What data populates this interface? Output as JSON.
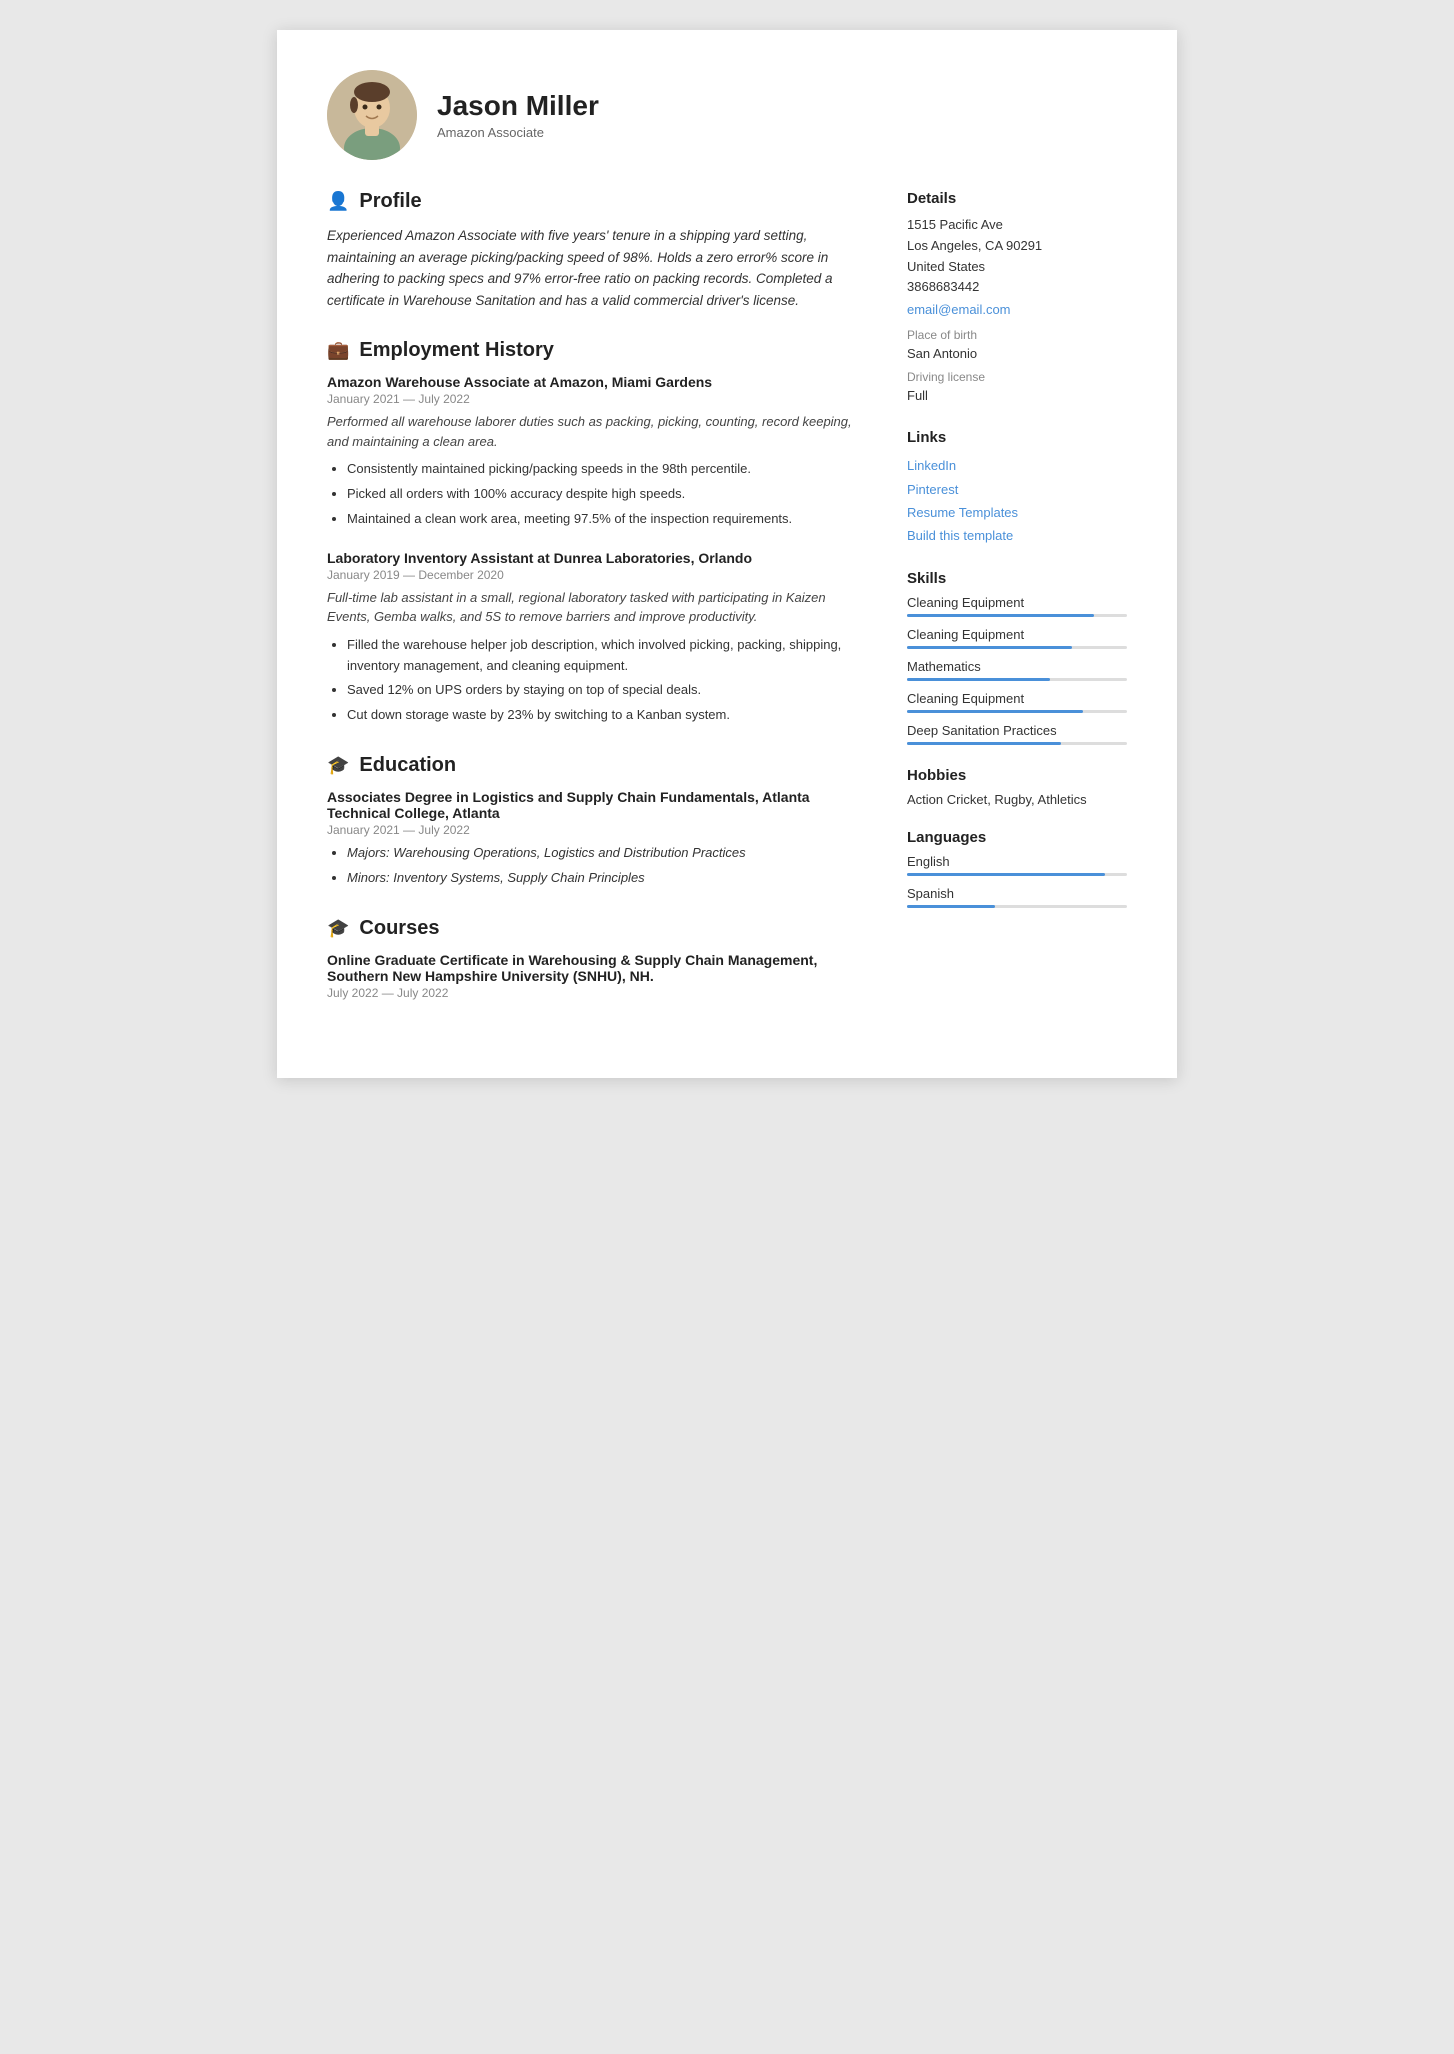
{
  "header": {
    "name": "Jason Miller",
    "subtitle": "Amazon Associate"
  },
  "profile": {
    "section_title": "Profile",
    "text": "Experienced Amazon Associate with five years' tenure in a shipping yard setting, maintaining an average picking/packing speed of 98%. Holds a zero error% score in adhering to packing specs and 97% error-free ratio on packing records. Completed a certificate in Warehouse Sanitation and has a valid commercial driver's license."
  },
  "employment": {
    "section_title": "Employment History",
    "jobs": [
      {
        "title": "Amazon Warehouse Associate at Amazon, Miami Gardens",
        "dates": "January 2021 — July 2022",
        "description": "Performed all warehouse laborer duties such as packing, picking, counting, record keeping, and maintaining a clean area.",
        "bullets": [
          "Consistently maintained picking/packing speeds in the 98th percentile.",
          "Picked all orders with 100% accuracy despite high speeds.",
          "Maintained a clean work area, meeting 97.5% of the inspection requirements."
        ]
      },
      {
        "title": "Laboratory Inventory Assistant  at  Dunrea Laboratories, Orlando",
        "dates": "January 2019 — December 2020",
        "description": "Full-time lab assistant in a small, regional laboratory tasked with participating in Kaizen Events, Gemba walks, and 5S to remove barriers and improve productivity.",
        "bullets": [
          "Filled the warehouse helper job description, which involved picking, packing, shipping, inventory management, and cleaning equipment.",
          "Saved 12% on UPS orders by staying on top of special deals.",
          "Cut down storage waste by 23% by switching to a Kanban system."
        ]
      }
    ]
  },
  "education": {
    "section_title": "Education",
    "entries": [
      {
        "title": "Associates Degree in Logistics and Supply Chain Fundamentals, Atlanta Technical College, Atlanta",
        "dates": "January 2021 — July 2022",
        "bullets": [
          "Majors: Warehousing Operations, Logistics and Distribution Practices",
          "Minors: Inventory Systems, Supply Chain Principles"
        ]
      }
    ]
  },
  "courses": {
    "section_title": "Courses",
    "entries": [
      {
        "title": "Online Graduate Certificate in Warehousing & Supply Chain Management, Southern New Hampshire University (SNHU), NH.",
        "dates": "July 2022 — July 2022"
      }
    ]
  },
  "details": {
    "section_title": "Details",
    "address_line1": "1515 Pacific Ave",
    "address_line2": "Los Angeles, CA 90291",
    "address_line3": "United States",
    "phone": "3868683442",
    "email": "email@email.com",
    "place_of_birth_label": "Place of birth",
    "place_of_birth": "San Antonio",
    "driving_license_label": "Driving license",
    "driving_license": "Full"
  },
  "links": {
    "section_title": "Links",
    "items": [
      {
        "label": "LinkedIn",
        "url": "#"
      },
      {
        "label": "Pinterest",
        "url": "#"
      },
      {
        "label": "Resume Templates",
        "url": "#"
      },
      {
        "label": "Build this template",
        "url": "#"
      }
    ]
  },
  "skills": {
    "section_title": "Skills",
    "items": [
      {
        "name": "Cleaning Equipment",
        "pct": 85
      },
      {
        "name": "Cleaning Equipment",
        "pct": 75
      },
      {
        "name": "Mathematics",
        "pct": 65
      },
      {
        "name": "Cleaning Equipment",
        "pct": 80
      },
      {
        "name": "Deep Sanitation Practices",
        "pct": 70
      }
    ]
  },
  "hobbies": {
    "section_title": "Hobbies",
    "text": "Action Cricket, Rugby, Athletics"
  },
  "languages": {
    "section_title": "Languages",
    "items": [
      {
        "name": "English",
        "pct": 90
      },
      {
        "name": "Spanish",
        "pct": 40
      }
    ]
  }
}
